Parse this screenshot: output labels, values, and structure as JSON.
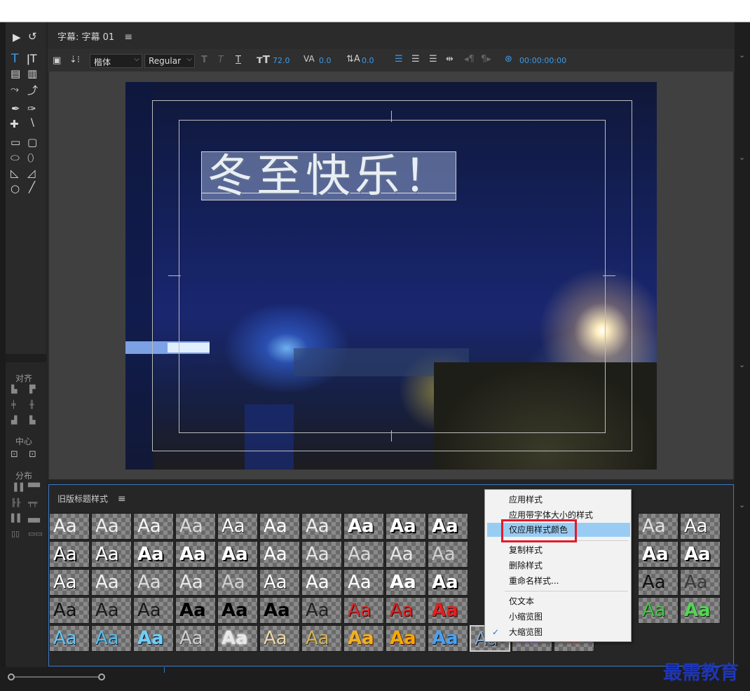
{
  "panel": {
    "title": "字幕: 字幕 01",
    "menu_glyph": "≡"
  },
  "toolbar": {
    "font_family": "楷体",
    "font_style": "Regular",
    "font_size": "72.0",
    "kerning": "0.0",
    "leading": "0.0",
    "timecode": "00:00:00:00"
  },
  "caption": {
    "text": "冬至快乐！"
  },
  "tools": {
    "align_label": "对齐",
    "center_label": "中心",
    "distribute_label": "分布"
  },
  "styles": {
    "title": "旧版标题样式",
    "menu_glyph": "≡",
    "swatch_text": "Aa"
  },
  "context_menu": {
    "items": [
      {
        "label": "应用样式"
      },
      {
        "label": "应用带字体大小的样式"
      },
      {
        "label": "仅应用样式颜色"
      },
      {
        "label": "复制样式"
      },
      {
        "label": "删除样式"
      },
      {
        "label": "重命名样式..."
      },
      {
        "label": "仅文本"
      },
      {
        "label": "小缩览图"
      },
      {
        "label": "大缩览图"
      }
    ],
    "check_glyph": "✓"
  },
  "watermark": {
    "text": "最需教育"
  },
  "colors": {
    "accent_blue": "#3d9be9",
    "highlight": "#99ccf2",
    "red_box": "#e21a2a"
  }
}
